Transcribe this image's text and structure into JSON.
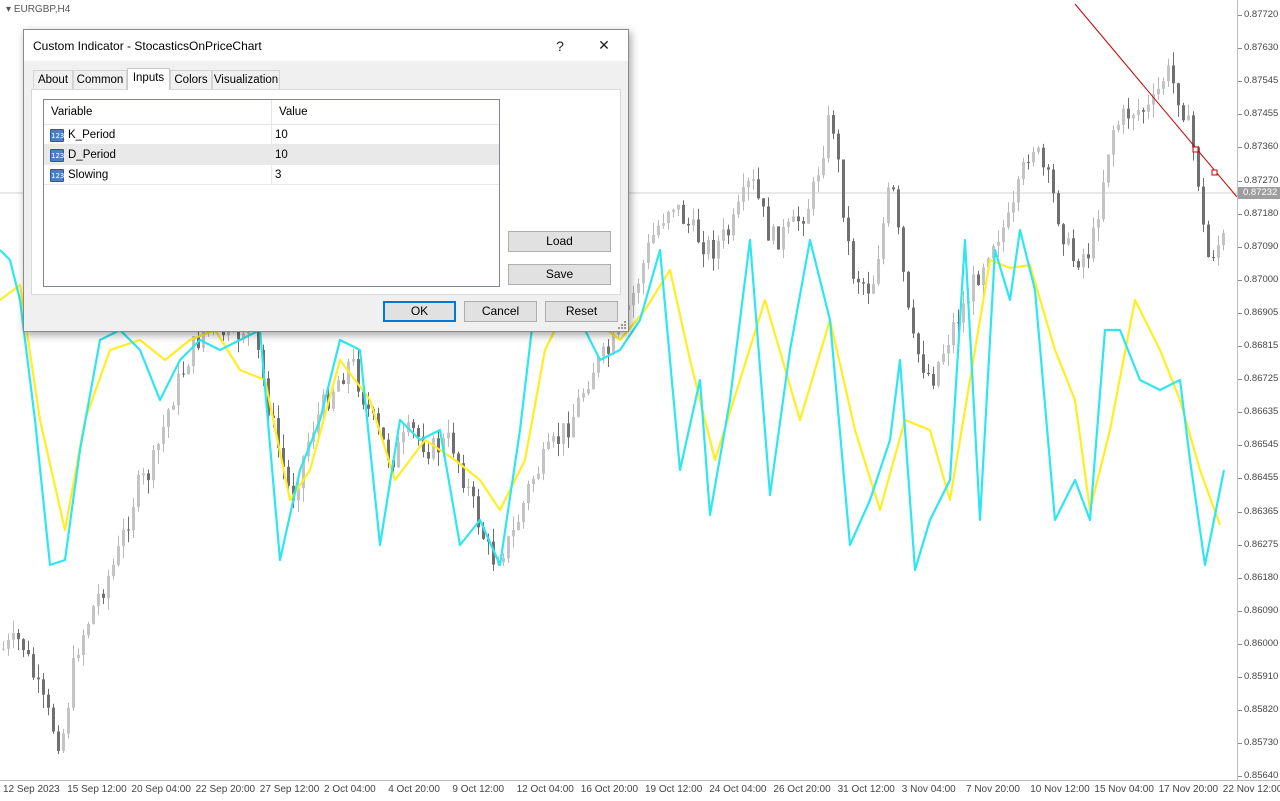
{
  "chart": {
    "symbol": "EURGBP,H4",
    "current_price": "0.87232",
    "price_labels": [
      "0.87720",
      "0.87630",
      "0.87545",
      "0.87455",
      "0.87360",
      "0.87270",
      "0.87180",
      "0.87090",
      "0.87000",
      "0.86905",
      "0.86815",
      "0.86725",
      "0.86635",
      "0.86545",
      "0.86455",
      "0.86365",
      "0.86275",
      "0.86180",
      "0.86090",
      "0.86000",
      "0.85910",
      "0.85820",
      "0.85730",
      "0.85640"
    ],
    "time_labels": [
      "12 Sep 2023",
      "15 Sep 12:00",
      "20 Sep 04:00",
      "22 Sep 20:00",
      "27 Sep 12:00",
      "2 Oct 04:00",
      "4 Oct 20:00",
      "9 Oct 12:00",
      "12 Oct 04:00",
      "16 Oct 20:00",
      "19 Oct 12:00",
      "24 Oct 04:00",
      "26 Oct 20:00",
      "31 Oct 12:00",
      "3 Nov 04:00",
      "7 Nov 20:00",
      "10 Nov 12:00",
      "15 Nov 04:00",
      "17 Nov 20:00",
      "22 Nov 12:00"
    ],
    "colors": {
      "k_line": "#2ee6f0",
      "d_line": "#ffee22",
      "candle": "#808080",
      "trendline": "#cc0000"
    }
  },
  "dialog": {
    "title": "Custom Indicator - StocasticsOnPriceChart",
    "help_label": "?",
    "close_label": "✕",
    "tabs": [
      "About",
      "Common",
      "Inputs",
      "Colors",
      "Visualization"
    ],
    "active_tab": "Inputs",
    "grid": {
      "headers": {
        "variable": "Variable",
        "value": "Value"
      },
      "icon_text": "123",
      "rows": [
        {
          "variable": "K_Period",
          "value": "10"
        },
        {
          "variable": "D_Period",
          "value": "10"
        },
        {
          "variable": "Slowing",
          "value": "3"
        }
      ]
    },
    "buttons": {
      "load": "Load",
      "save": "Save",
      "ok": "OK",
      "cancel": "Cancel",
      "reset": "Reset"
    }
  }
}
